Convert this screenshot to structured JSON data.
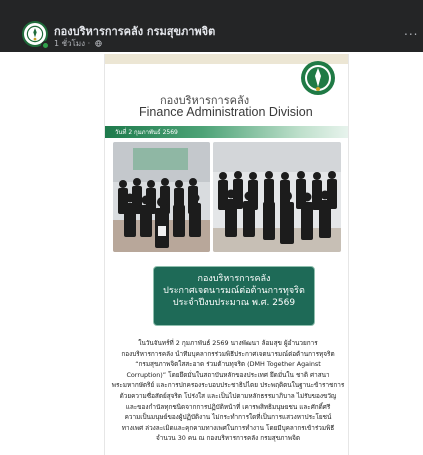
{
  "post_header": {
    "page_name": "กองบริหารการคลัง กรมสุขภาพจิต",
    "time_ago": "1 ชั่วโมง ·",
    "privacy_icon": "globe-icon",
    "more_label": "..."
  },
  "colors": {
    "header_bg": "#242526",
    "accent_green": "#1e6a57",
    "strip_green": "#1e7a4c"
  },
  "post_image": {
    "banner_title_th": "กองบริหารการคลัง",
    "banner_title_en": "Finance Administration Division",
    "date_label": "วันที่ 2 กุมภาพันธ์ 2569",
    "title_box": {
      "line1": "กองบริหารการคลัง",
      "line2": "ประกาศเจตนารมณ์ต่อต้านการทุจริต",
      "line3": "ประจำปีงบประมาณ พ.ศ. 2569"
    },
    "body_lines": [
      "ในวันจันทร์ที่ 2 กุมภาพันธ์ 2569 นางพัฒนา ล้อมสุข ผู้อำนวยการ",
      "กองบริหารการคลัง นำทีมบุคลากรร่วมพิธีประกาศเจตนารมณ์ต่อต้านการทุจริต",
      "“กรมสุขภาพจิตใสสะอาด ร่วมต้านทุจริต (DMH Together Against",
      "Corruption)” โดยยึดมั่นในสถาบันหลักของประเทศ ยึดมั่นใน ชาติ ศาสนา",
      "พระมหากษัตริย์ และการปกครองระบอบประชาธิปไตย ประพฤติตนในฐานะข้าราชการ",
      "ด้วยความซื่อสัตย์สุจริต โปร่งใส และเป็นไปตามหลักธรรมาภิบาล ไม่รับของขวัญ",
      "และของกำนัลทุกชนิดจากการปฏิบัติหน้าที่ เคารพสิทธิมนุษยชน และศักดิ์ศรี",
      "ความเป็นมนุษย์ของผู้ปฏิบัติงาน ไม่กระทำการใดที่เป็นการแสวงหาประโยชน์",
      "ทางเพศ ล่วงละเมิดและคุกคามทางเพศในการทำงาน โดยมีบุคลากรเข้าร่วมพิธี",
      "จำนวน 30 คน ณ กองบริหารการคลัง กรมสุขภาพจิต"
    ]
  }
}
